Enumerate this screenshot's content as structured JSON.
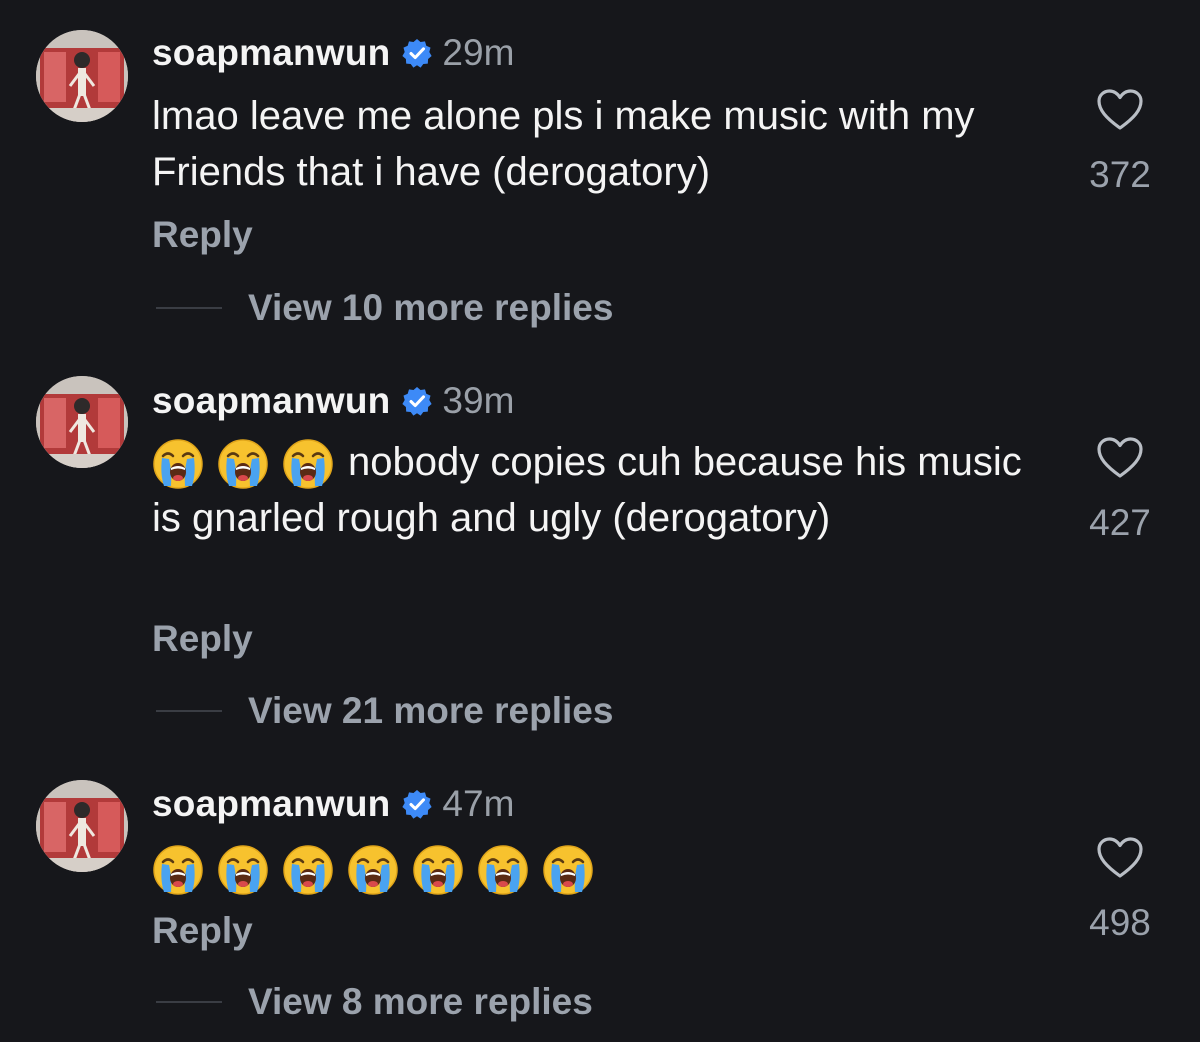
{
  "comments": [
    {
      "username": "soapmanwun",
      "time": "29m",
      "text": "lmao leave me alone pls i make music with my Friends that i have (derogatory)",
      "emoji_count": 0,
      "likes": "372",
      "reply_label": "Reply",
      "view_replies": "View 10 more replies"
    },
    {
      "username": "soapmanwun",
      "time": "39m",
      "text": "nobody copies cuh because his music is gnarled rough and ugly (derogatory)",
      "emoji_count": 3,
      "likes": "427",
      "reply_label": "Reply",
      "view_replies": "View 21 more replies"
    },
    {
      "username": "soapmanwun",
      "time": "47m",
      "text": "",
      "emoji_count": 7,
      "likes": "498",
      "reply_label": "Reply",
      "view_replies": "View 8 more replies"
    }
  ],
  "icons": {
    "verified": "verified-badge-icon",
    "like": "heart-outline-icon",
    "emoji": "loudly-crying-face-emoji"
  },
  "colors": {
    "background": "#16171b",
    "verified": "#3d8af7",
    "muted": "#9ba2ac"
  }
}
